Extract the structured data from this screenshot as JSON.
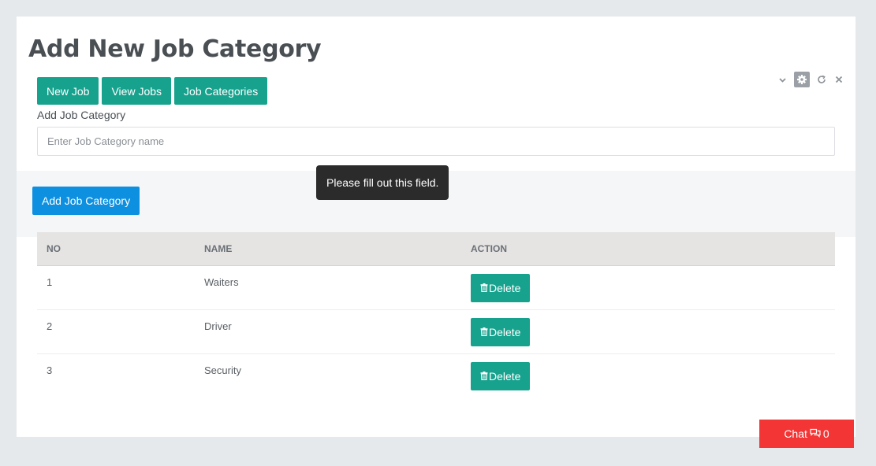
{
  "page": {
    "title": "Add New Job Category"
  },
  "nav_buttons": {
    "new_job": "New Job",
    "view_jobs": "View Jobs",
    "job_categories": "Job Categories"
  },
  "form": {
    "label": "Add Job Category",
    "input_value": "",
    "input_placeholder": "Enter Job Category name",
    "submit_label": "Add Job Category",
    "validation_tooltip": "Please fill out this field."
  },
  "table": {
    "columns": [
      "NO",
      "NAME",
      "ACTION"
    ],
    "rows": [
      {
        "no": "1",
        "name": "Waiters",
        "action": "Delete"
      },
      {
        "no": "2",
        "name": "Driver",
        "action": "Delete"
      },
      {
        "no": "3",
        "name": "Security",
        "action": "Delete"
      }
    ]
  },
  "panel_tools": [
    "chevron-down-icon",
    "gear-icon",
    "refresh-icon",
    "close-icon"
  ],
  "chat": {
    "label": "Chat",
    "count": "0"
  },
  "colors": {
    "teal": "#17a28e",
    "blue": "#0e90e0",
    "chat_red": "#f43535",
    "tooltip_bg": "#2b2b2b",
    "header_bg": "#e5e4e2"
  }
}
